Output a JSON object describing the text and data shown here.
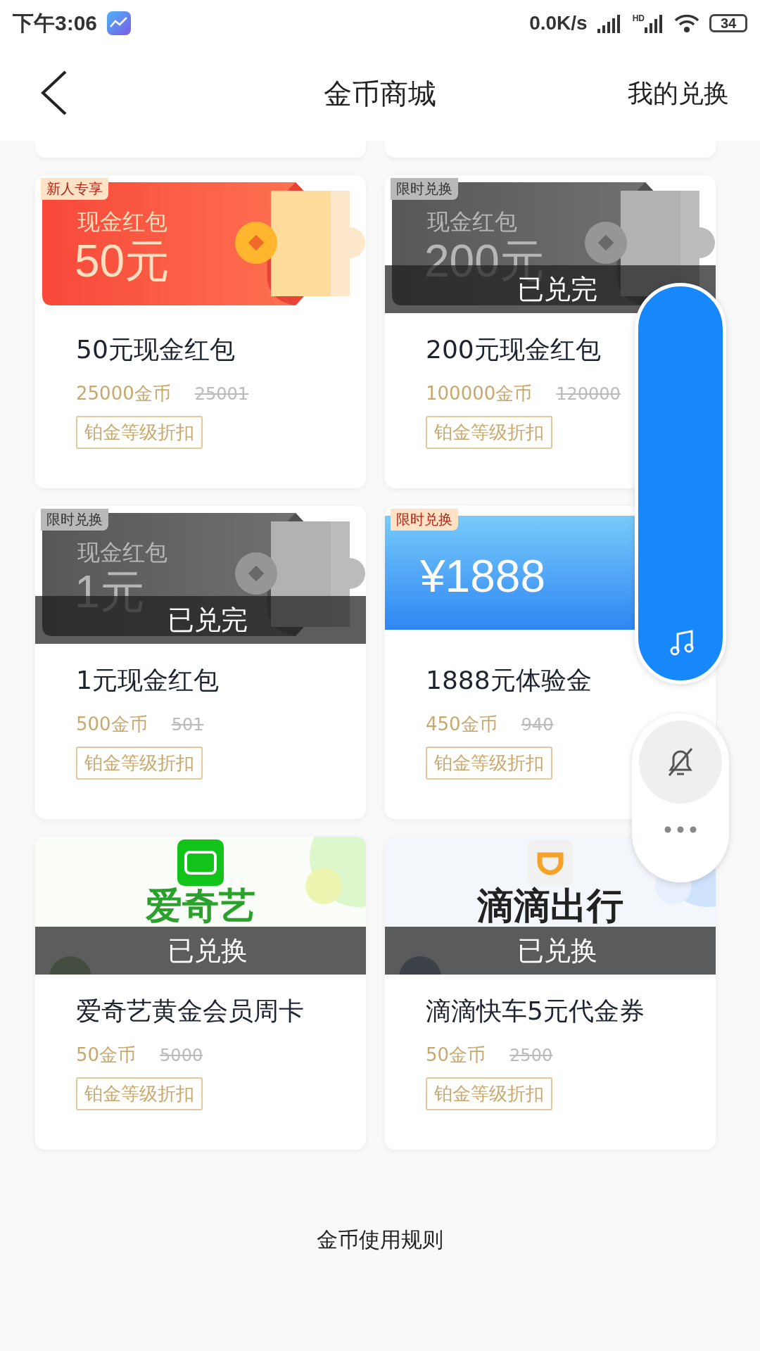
{
  "status_bar": {
    "time": "下午3:06",
    "net_speed": "0.0K/s",
    "hd": "HD",
    "battery": "34"
  },
  "header": {
    "title": "金币商城",
    "action": "我的兑换"
  },
  "cards": [
    {
      "tag": "新人专享",
      "greyed": false,
      "banner": {
        "kind": "red_packet",
        "label": "现金红包",
        "amount": "50元"
      },
      "name": "50元现金红包",
      "price": "25000金币",
      "original_price": "25001",
      "badge": "铂金等级折扣"
    },
    {
      "tag": "限时兑换",
      "greyed": true,
      "status": "已兑完",
      "banner": {
        "kind": "red_packet",
        "label": "现金红包",
        "amount": "200元"
      },
      "name": "200元现金红包",
      "price": "100000金币",
      "original_price": "120000",
      "badge": "铂金等级折扣"
    },
    {
      "tag": "限时兑换",
      "greyed": true,
      "status": "已兑完",
      "banner": {
        "kind": "red_packet",
        "label": "现金红包",
        "amount": "1元"
      },
      "name": "1元现金红包",
      "price": "500金币",
      "original_price": "501",
      "badge": "铂金等级折扣"
    },
    {
      "tag": "限时兑换",
      "greyed": false,
      "banner": {
        "kind": "coupon",
        "amount": "¥1888"
      },
      "name": "1888元体验金",
      "price": "450金币",
      "original_price": "940",
      "badge": "铂金等级折扣"
    },
    {
      "greyed": false,
      "status": "已兑换",
      "banner": {
        "kind": "brand_tv",
        "color": "#12c41a",
        "brand": "爱奇艺"
      },
      "name": "爱奇艺黄金会员周卡",
      "price": "50金币",
      "original_price": "5000",
      "badge": "铂金等级折扣"
    },
    {
      "greyed": false,
      "status": "已兑换",
      "banner": {
        "kind": "brand_arc",
        "color": "#f6a128",
        "brand": "滴滴出行"
      },
      "name": "滴滴快车5元代金券",
      "price": "50金币",
      "original_price": "2500",
      "badge": "铂金等级折扣"
    }
  ],
  "rules_link": "金币使用规则",
  "floating_panel": {
    "bell_muted": true
  }
}
